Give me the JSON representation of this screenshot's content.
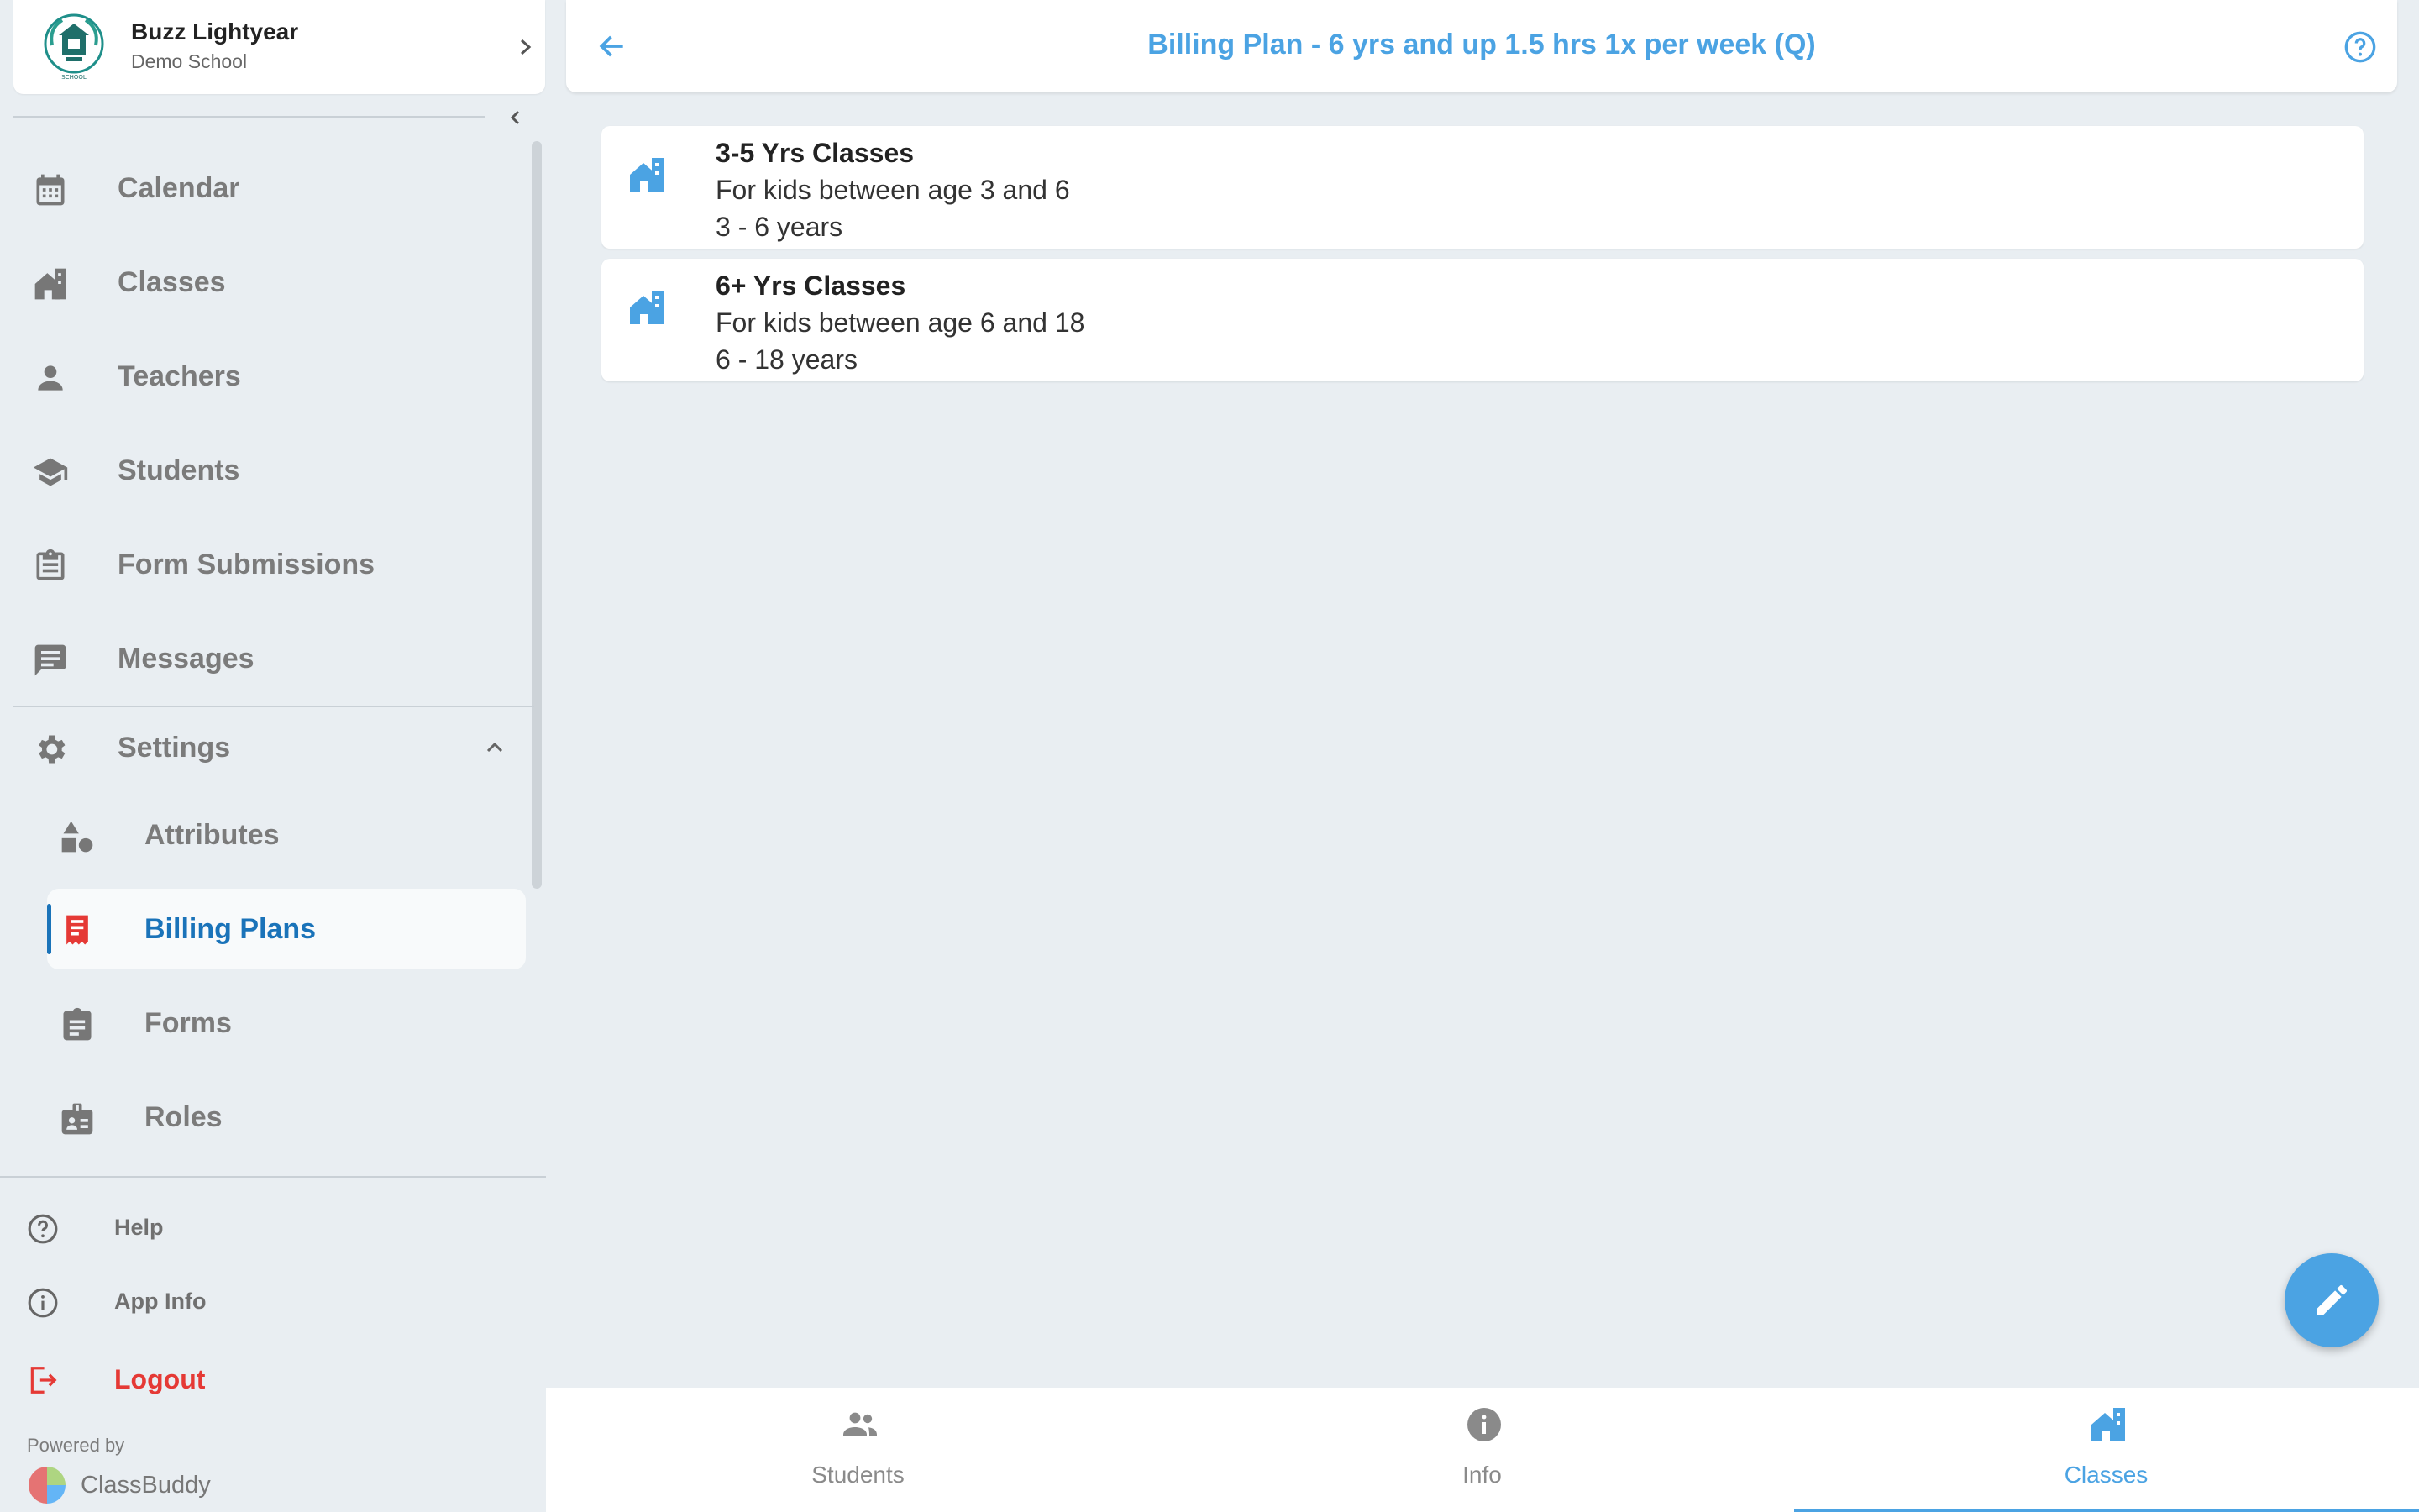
{
  "profile": {
    "name": "Buzz Lightyear",
    "school": "Demo School"
  },
  "sidebar": {
    "items": [
      {
        "label": "Calendar",
        "icon": "calendar-icon"
      },
      {
        "label": "Classes",
        "icon": "classes-icon"
      },
      {
        "label": "Teachers",
        "icon": "person-icon"
      },
      {
        "label": "Students",
        "icon": "graduation-cap-icon"
      },
      {
        "label": "Form Submissions",
        "icon": "clipboard-list-icon"
      },
      {
        "label": "Messages",
        "icon": "message-icon"
      }
    ],
    "settings": {
      "label": "Settings",
      "icon": "gear-icon",
      "expanded": true,
      "subitems": [
        {
          "label": "Attributes",
          "icon": "shapes-icon"
        },
        {
          "label": "Billing Plans",
          "icon": "receipt-icon",
          "active": true
        },
        {
          "label": "Forms",
          "icon": "clipboard-icon"
        },
        {
          "label": "Roles",
          "icon": "id-badge-icon"
        }
      ]
    },
    "footer": [
      {
        "label": "Help",
        "icon": "help-circle-icon"
      },
      {
        "label": "App Info",
        "icon": "info-circle-icon"
      },
      {
        "label": "Logout",
        "icon": "logout-icon"
      }
    ],
    "powered_by": "Powered by",
    "brand": "ClassBuddy"
  },
  "header": {
    "title": "Billing Plan - 6 yrs and up 1.5 hrs 1x per week (Q)"
  },
  "classes": [
    {
      "name": "3-5 Yrs Classes",
      "description": "For kids between age 3 and 6",
      "range": "3 - 6 years"
    },
    {
      "name": "6+ Yrs Classes",
      "description": "For kids between age 6 and 18",
      "range": "6 - 18 years"
    }
  ],
  "bottom_nav": {
    "tabs": [
      {
        "label": "Students",
        "icon": "group-icon"
      },
      {
        "label": "Info",
        "icon": "info-icon"
      },
      {
        "label": "Classes",
        "icon": "classes-icon",
        "active": true
      }
    ]
  },
  "colors": {
    "accent": "#4ba3e3",
    "active_nav": "#1a73b9",
    "logout": "#e53935",
    "billing_icon": "#e53935",
    "background": "#e9eef2"
  }
}
